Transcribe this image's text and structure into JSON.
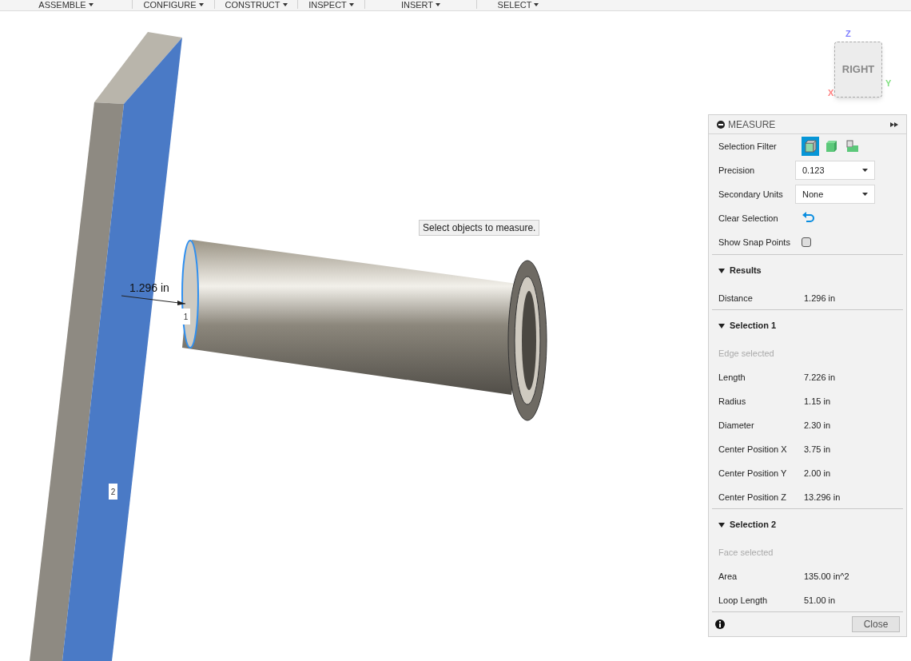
{
  "toolbar": {
    "menus": [
      {
        "label": "ASSEMBLE"
      },
      {
        "label": "CONFIGURE"
      },
      {
        "label": "CONSTRUCT"
      },
      {
        "label": "INSPECT"
      },
      {
        "label": "INSERT"
      },
      {
        "label": "SELECT"
      }
    ]
  },
  "viewcube": {
    "face": "RIGHT",
    "axis_z": "Z",
    "axis_y": "Y",
    "axis_x": "X"
  },
  "viewport": {
    "hint": "Select objects to measure.",
    "dimension": "1.296 in",
    "marker_1": "1",
    "marker_2": "2"
  },
  "measure_panel": {
    "title": "MEASURE",
    "selection_filter": {
      "label": "Selection Filter",
      "options": [
        {
          "selected": true
        },
        {
          "selected": false
        },
        {
          "selected": false
        }
      ]
    },
    "precision": {
      "label": "Precision",
      "value": "0.123"
    },
    "secondary_units": {
      "label": "Secondary Units",
      "value": "None"
    },
    "clear_selection": {
      "label": "Clear Selection"
    },
    "show_snap_points": {
      "label": "Show Snap Points",
      "checked": false
    },
    "sections": [
      {
        "title": "Results",
        "expanded": true,
        "rows": [
          {
            "kind": "value",
            "label": "Distance",
            "value": "1.296 in"
          }
        ]
      },
      {
        "title": "Selection 1",
        "expanded": true,
        "rows": [
          {
            "kind": "hint",
            "label": "Edge selected"
          },
          {
            "kind": "value",
            "label": "Length",
            "value": "7.226 in"
          },
          {
            "kind": "value",
            "label": "Radius",
            "value": "1.15 in"
          },
          {
            "kind": "value",
            "label": "Diameter",
            "value": "2.30 in"
          },
          {
            "kind": "value",
            "label": "Center Position X",
            "value": "3.75 in"
          },
          {
            "kind": "value",
            "label": "Center Position Y",
            "value": "2.00 in"
          },
          {
            "kind": "value",
            "label": "Center Position Z",
            "value": "13.296 in"
          }
        ]
      },
      {
        "title": "Selection 2",
        "expanded": true,
        "rows": [
          {
            "kind": "hint",
            "label": "Face selected"
          },
          {
            "kind": "value",
            "label": "Area",
            "value": "135.00 in^2"
          },
          {
            "kind": "value",
            "label": "Loop Length",
            "value": "51.00 in"
          }
        ]
      }
    ],
    "close_button": "Close"
  }
}
